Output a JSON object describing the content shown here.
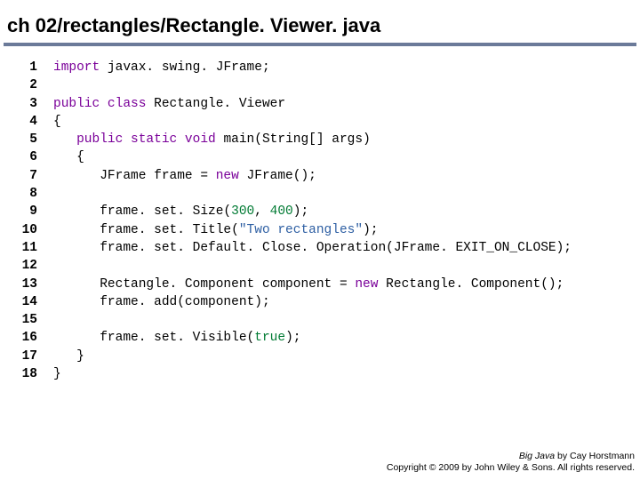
{
  "header": {
    "title": "ch 02/rectangles/Rectangle. Viewer. java"
  },
  "code": {
    "lines": [
      {
        "n": "1",
        "tokens": [
          {
            "c": "kw",
            "t": "import"
          },
          {
            "c": "plain",
            "t": " javax. swing. JFrame;"
          }
        ]
      },
      {
        "n": "2",
        "tokens": []
      },
      {
        "n": "3",
        "tokens": [
          {
            "c": "kw",
            "t": "public class"
          },
          {
            "c": "plain",
            "t": " Rectangle. Viewer"
          }
        ]
      },
      {
        "n": "4",
        "tokens": [
          {
            "c": "plain",
            "t": "{"
          }
        ]
      },
      {
        "n": "5",
        "tokens": [
          {
            "c": "plain",
            "t": "   "
          },
          {
            "c": "kw",
            "t": "public static void"
          },
          {
            "c": "plain",
            "t": " main(String[] args)"
          }
        ]
      },
      {
        "n": "6",
        "tokens": [
          {
            "c": "plain",
            "t": "   {"
          }
        ]
      },
      {
        "n": "7",
        "tokens": [
          {
            "c": "plain",
            "t": "      JFrame frame = "
          },
          {
            "c": "kw",
            "t": "new"
          },
          {
            "c": "plain",
            "t": " JFrame();"
          }
        ]
      },
      {
        "n": "8",
        "tokens": []
      },
      {
        "n": "9",
        "tokens": [
          {
            "c": "plain",
            "t": "      frame. set. Size("
          },
          {
            "c": "num",
            "t": "300"
          },
          {
            "c": "plain",
            "t": ", "
          },
          {
            "c": "num",
            "t": "400"
          },
          {
            "c": "plain",
            "t": ");"
          }
        ]
      },
      {
        "n": "10",
        "tokens": [
          {
            "c": "plain",
            "t": "      frame. set. Title("
          },
          {
            "c": "str",
            "t": "\"Two rectangles\""
          },
          {
            "c": "plain",
            "t": ");"
          }
        ]
      },
      {
        "n": "11",
        "tokens": [
          {
            "c": "plain",
            "t": "      frame. set. Default. Close. Operation(JFrame. EXIT_ON_CLOSE);"
          }
        ]
      },
      {
        "n": "12",
        "tokens": []
      },
      {
        "n": "13",
        "tokens": [
          {
            "c": "plain",
            "t": "      Rectangle. Component component = "
          },
          {
            "c": "kw",
            "t": "new"
          },
          {
            "c": "plain",
            "t": " Rectangle. Component();"
          }
        ]
      },
      {
        "n": "14",
        "tokens": [
          {
            "c": "plain",
            "t": "      frame. add(component);"
          }
        ]
      },
      {
        "n": "15",
        "tokens": []
      },
      {
        "n": "16",
        "tokens": [
          {
            "c": "plain",
            "t": "      frame. set. Visible("
          },
          {
            "c": "num",
            "t": "true"
          },
          {
            "c": "plain",
            "t": ");"
          }
        ]
      },
      {
        "n": "17",
        "tokens": [
          {
            "c": "plain",
            "t": "   }"
          }
        ]
      },
      {
        "n": "18",
        "tokens": [
          {
            "c": "plain",
            "t": "}"
          }
        ]
      }
    ]
  },
  "footer": {
    "line1_book": "Big Java",
    "line1_rest": " by Cay Horstmann",
    "line2": "Copyright © 2009 by John Wiley & Sons. All rights reserved."
  }
}
